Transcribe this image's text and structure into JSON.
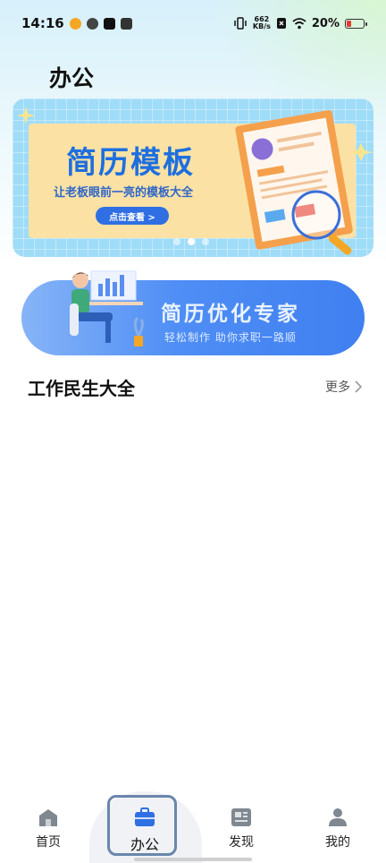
{
  "status_bar": {
    "time": "14:16",
    "net_speed_value": "662",
    "net_speed_unit": "KB/s",
    "battery": "20%"
  },
  "page": {
    "title": "办公"
  },
  "banner": {
    "title": "简历模板",
    "subtitle": "让老板眼前一亮的模板大全",
    "button": "点击查看 >",
    "page_count": 3,
    "active_page": 1
  },
  "promo": {
    "title": "简历优化专家",
    "subtitle": "轻松制作 助你求职一路顺"
  },
  "section": {
    "title": "工作民生大全",
    "more": "更多"
  },
  "bottom_nav": {
    "items": [
      {
        "label": "首页",
        "icon": "home-icon"
      },
      {
        "label": "办公",
        "icon": "briefcase-icon"
      },
      {
        "label": "发现",
        "icon": "news-icon"
      },
      {
        "label": "我的",
        "icon": "user-icon"
      }
    ],
    "active_index": 1
  },
  "colors": {
    "accent_blue": "#2f6fe3",
    "banner_bg": "#9fdcf8",
    "banner_card": "#fbe2a4",
    "battery_low": "#e53935"
  }
}
